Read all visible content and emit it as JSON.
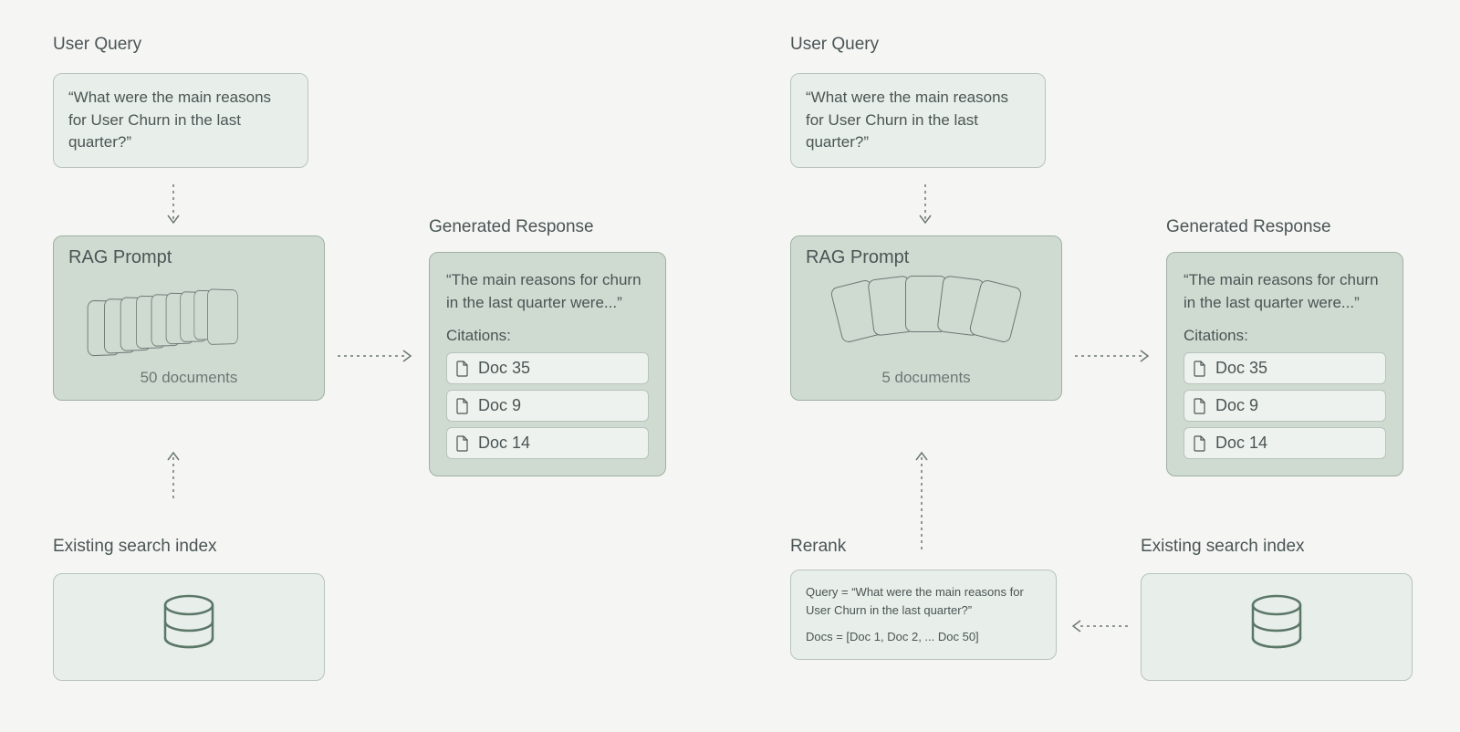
{
  "left": {
    "user_query_label": "User Query",
    "user_query_text": "“What were the main reasons for User Churn in the last quarter?”",
    "rag_label": "RAG Prompt",
    "doc_count": "50 documents",
    "response_label": "Generated Response",
    "response_text": "“The main reasons for churn in the last quarter were...”",
    "citations_label": "Citations:",
    "citations": [
      "Doc 35",
      "Doc 9",
      "Doc 14"
    ],
    "index_label": "Existing search index"
  },
  "right": {
    "user_query_label": "User Query",
    "user_query_text": "“What were the main reasons for User Churn in the last quarter?”",
    "rag_label": "RAG Prompt",
    "doc_count": "5 documents",
    "response_label": "Generated Response",
    "response_text": "“The main reasons for churn in the last quarter were...”",
    "citations_label": "Citations:",
    "citations": [
      "Doc 35",
      "Doc 9",
      "Doc 14"
    ],
    "index_label": "Existing search index",
    "rerank_label": "Rerank",
    "rerank_query": "Query = “What were the main reasons for User Churn in the last quarter?”",
    "rerank_docs": "Docs = [Doc 1, Doc 2, ... Doc 50]"
  }
}
